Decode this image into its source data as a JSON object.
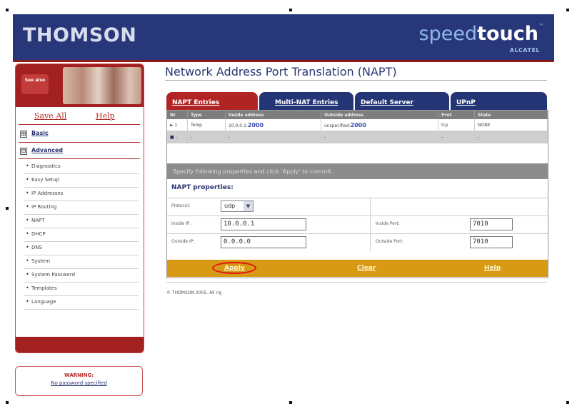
{
  "header": {
    "brand": "THOMSON",
    "brand_small": "",
    "product_light": "speed",
    "product_bold": "touch",
    "product_tm": "™",
    "sub": "ALCATEL"
  },
  "sidebar": {
    "see_also": "See also",
    "links": {
      "save_all": "Save All",
      "help": "Help"
    },
    "sections": [
      {
        "box": "⊞",
        "label": "Basic"
      },
      {
        "box": "⊟",
        "label": "Advanced"
      }
    ],
    "items": [
      "Diagnostics",
      "Easy Setup",
      "IP Addresses",
      "IP Routing",
      "NAPT",
      "DHCP",
      "DNS",
      "System",
      "System Password",
      "Templates",
      "Language"
    ],
    "bullet": "•"
  },
  "warning": {
    "title": "WARNING:",
    "text": "No password specified"
  },
  "main": {
    "title": "Network Address Port Translation (NAPT)",
    "tabs": [
      "NAPT Entries",
      "Multi-NAT Entries",
      "Default Server",
      "UPnP"
    ],
    "table": {
      "headers": [
        "Nr",
        "Type",
        "Inside address",
        "Outside address",
        "Prot",
        "State"
      ],
      "rows": [
        {
          "marker": "►",
          "nr": "1",
          "type": "Temp",
          "inside_ip": "10.0.0.1:",
          "inside_port": "2000",
          "outside_ip": "unspecified:",
          "outside_port": "2000",
          "prot": "tcp",
          "state": "NONE"
        },
        {
          "marker": "■",
          "nr": "-",
          "type": "-",
          "inside_ip": "-",
          "inside_port": "",
          "outside_ip": "-",
          "outside_port": "",
          "prot": "-",
          "state": "-"
        }
      ]
    },
    "instructions": "Specify following properties and click 'Apply' to commit.",
    "properties_title": "NAPT properties:",
    "form": {
      "protocol_label": "Protocol:",
      "protocol_value": "udp",
      "protocol_arrow": "▼",
      "inside_ip_label": "Inside IP:",
      "inside_ip_value": "10.0.0.1",
      "outside_ip_label": "Outside IP:",
      "outside_ip_value": "0.0.0.0",
      "inside_port_label": "Inside Port:",
      "inside_port_value": "7010",
      "outside_port_label": "Outside Port:",
      "outside_port_value": "7010"
    },
    "actions": {
      "apply": "Apply",
      "clear": "Clear",
      "help": "Help"
    },
    "copyright": "© THOMSON 2005. All rig"
  },
  "colors": {
    "header_blue": "#273779",
    "accent_red": "#b12424",
    "action_gold": "#d89a14",
    "highlight_circle": "#e01010"
  }
}
